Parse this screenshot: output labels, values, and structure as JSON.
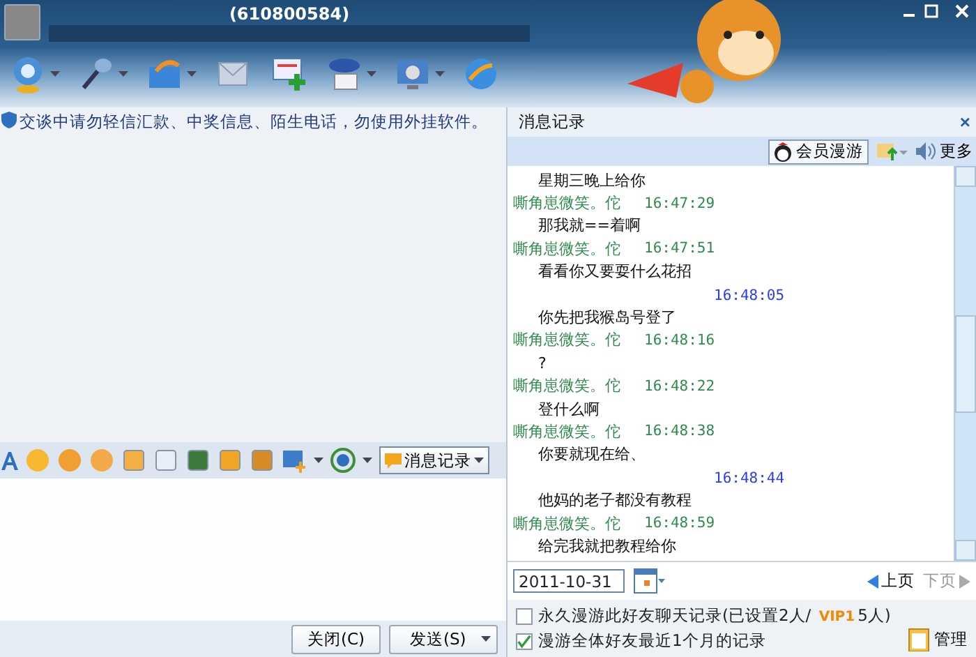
{
  "window": {
    "title": "(610800584)"
  },
  "notice": "交谈中请勿轻信汇款、中奖信息、陌生电话，勿使用外挂软件。",
  "format_toolbar": {
    "history_button": "消息记录"
  },
  "buttons": [
    {
      "label": "关闭(C)",
      "kind": "plain"
    },
    {
      "label": "发送(S)",
      "kind": "split"
    }
  ],
  "history": {
    "title": "消息记录",
    "close": "×",
    "roam_button": "会员漫游",
    "more": "更多",
    "messages": [
      {
        "kind": "text",
        "text": "星期三晚上给你"
      },
      {
        "kind": "sender",
        "name": "嘶角崽微笑。佗",
        "time": "16:47:29"
      },
      {
        "kind": "text",
        "text": "那我就==着啊"
      },
      {
        "kind": "sender",
        "name": "嘶角崽微笑。佗",
        "time": "16:47:51"
      },
      {
        "kind": "text",
        "text": "看看你又要耍什么花招"
      },
      {
        "kind": "time",
        "time": "16:48:05"
      },
      {
        "kind": "text",
        "text": "你先把我猴岛号登了"
      },
      {
        "kind": "sender",
        "name": "嘶角崽微笑。佗",
        "time": "16:48:16"
      },
      {
        "kind": "text",
        "text": "?"
      },
      {
        "kind": "sender",
        "name": "嘶角崽微笑。佗",
        "time": "16:48:22"
      },
      {
        "kind": "text",
        "text": "登什么啊"
      },
      {
        "kind": "sender",
        "name": "嘶角崽微笑。佗",
        "time": "16:48:38"
      },
      {
        "kind": "text",
        "text": "你要就现在给、"
      },
      {
        "kind": "time",
        "time": "16:48:44"
      },
      {
        "kind": "text",
        "text": "他妈的老子都没有教程"
      },
      {
        "kind": "sender",
        "name": "嘶角崽微笑。佗",
        "time": "16:48:59"
      },
      {
        "kind": "text",
        "text": "给完我就把教程给你"
      }
    ],
    "date": "2011-10-31",
    "pager": [
      {
        "label": "上页",
        "disabled": false
      },
      {
        "label": "下页",
        "disabled": true
      }
    ],
    "options": [
      {
        "text": "永久漫游此好友聊天记录(已设置2人/ ",
        "badge": "VIP1",
        "suffix": "5人)",
        "checked": false
      },
      {
        "text": "漫游全体好友最近1个月的记录",
        "checked": true
      }
    ],
    "manage_button": "管理"
  }
}
